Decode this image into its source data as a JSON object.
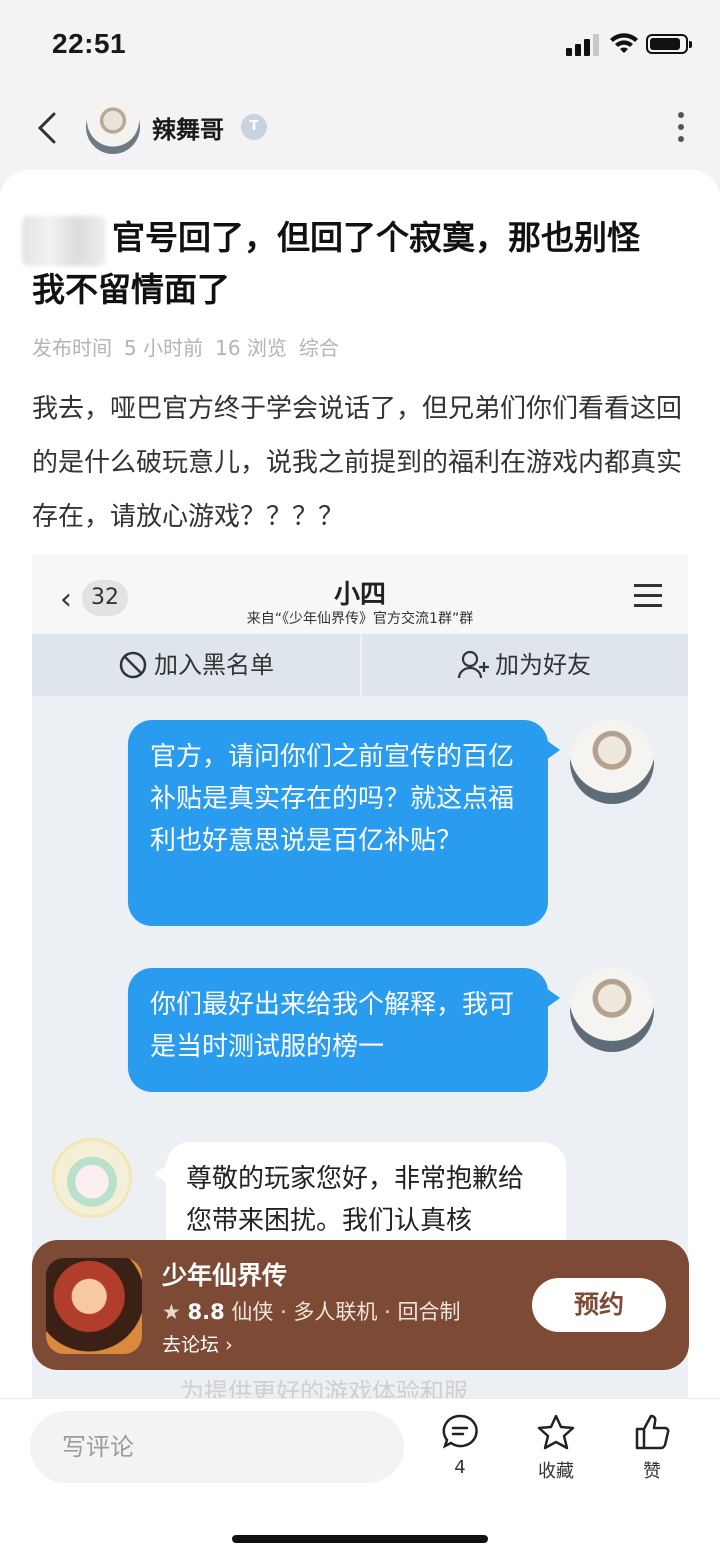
{
  "status": {
    "time": "22:51"
  },
  "author": {
    "name": "辣舞哥",
    "badge": "T"
  },
  "post": {
    "title": "官号回了，但回了个寂寞，那也别怪我不留情面了",
    "meta": [
      "发布时间",
      "5 小时前",
      "16 浏览",
      "综合"
    ],
    "body": "我去，哑巴官方终于学会说话了，但兄弟们你们看看这回的是什么破玩意儿，说我之前提到的福利在游戏内都真实存在，请放心游戏？？？？"
  },
  "screenshot": {
    "back_count": "32",
    "chat_name": "小四",
    "chat_sub": "来自“《少年仙界传》官方交流1群”群",
    "block_label": "加入黑名单",
    "add_friend_label": "加为好友",
    "msg1": "官方，请问你们之前宣传的百亿补贴是真实存在的吗？就这点福利也好意思说是百亿补贴？",
    "msg2": "你们最好出来给我个解释，我可是当时测试服的榜一",
    "reply": "尊敬的玩家您好，非常抱歉给您带来困扰。我们认真核",
    "peek": "为提供更好的游戏体验和服"
  },
  "promo": {
    "game_name": "少年仙界传",
    "rating": "8.8",
    "tags": "仙侠 · 多人联机 · 回合制",
    "forum_link": "去论坛",
    "book_button": "预约"
  },
  "bottom": {
    "comment_placeholder": "写评论",
    "comment_count": "4",
    "favorite_label": "收藏",
    "like_label": "赞"
  },
  "colors": {
    "accent": "#2a9cf0",
    "promo_bg": "#7c4a35"
  },
  "icons": [
    "back-icon",
    "more-icon",
    "signal-icon",
    "wifi-icon",
    "battery-icon",
    "comment-icon",
    "star-icon",
    "thumbs-up-icon",
    "block-icon",
    "add-friend-icon",
    "menu-icon",
    "chevron-right-icon"
  ]
}
